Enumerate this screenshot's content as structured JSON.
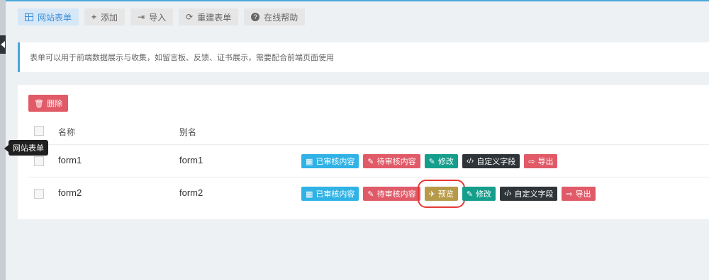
{
  "tabs": [
    {
      "label": "网站表单",
      "icon": "table-icon",
      "active": true
    },
    {
      "label": "添加",
      "icon": "plus-icon"
    },
    {
      "label": "导入",
      "icon": "import-icon"
    },
    {
      "label": "重建表单",
      "icon": "refresh-icon"
    },
    {
      "label": "在线帮助",
      "icon": "help-icon"
    }
  ],
  "info": {
    "text": "表单可以用于前端数据展示与收集，如留言板、反馈、证书展示，需要配合前端页面使用"
  },
  "toolbar": {
    "delete_label": "删除"
  },
  "table": {
    "headers": {
      "name": "名称",
      "alias": "别名"
    },
    "rows": [
      {
        "name": "form1",
        "alias": "form1",
        "actions": [
          "已审核内容",
          "待审核内容",
          "修改",
          "自定义字段",
          "导出"
        ]
      },
      {
        "name": "form2",
        "alias": "form2",
        "actions": [
          "已审核内容",
          "待审核内容",
          "预览",
          "修改",
          "自定义字段",
          "导出"
        ]
      }
    ]
  },
  "tooltip": {
    "text": "网站表单"
  },
  "colors": {
    "accent": "#4aa8d8",
    "blue": "#2fb2e6",
    "red": "#e05a67",
    "teal": "#159e8c",
    "dark": "#2e3438",
    "gold": "#b79a48",
    "highlight": "#e53935"
  }
}
